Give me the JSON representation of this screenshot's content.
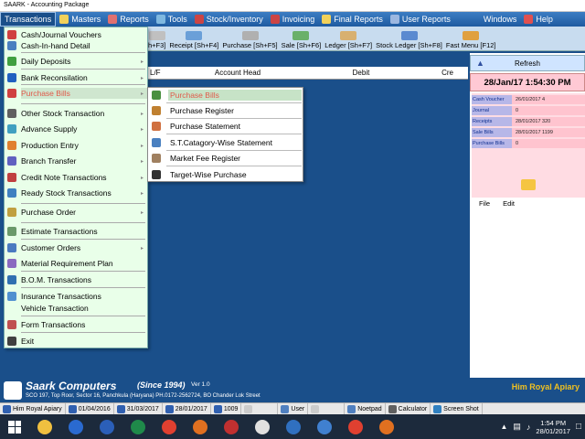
{
  "window_title": "SAARK - Accounting Package",
  "menubar": [
    {
      "label": "Transactions",
      "icon": "",
      "active": true
    },
    {
      "label": "Masters",
      "icon": "masters-icon",
      "color": "#f2d15a"
    },
    {
      "label": "Reports",
      "icon": "reports-icon",
      "color": "#e07070"
    },
    {
      "label": "Tools",
      "icon": "tools-icon",
      "color": "#7fb8e0"
    },
    {
      "label": "Stock/Inventory",
      "icon": "stock-icon",
      "color": "#cc4444"
    },
    {
      "label": "Invoicing",
      "icon": "invoicing-icon",
      "color": "#cc4444"
    },
    {
      "label": "Final Reports",
      "icon": "final-reports-icon",
      "color": "#f2d15a"
    },
    {
      "label": "User Reports",
      "icon": "user-reports-icon",
      "color": "#9cb7e0"
    },
    {
      "label": "Windows",
      "icon": "",
      "color": ""
    },
    {
      "label": "Help",
      "icon": "help-icon",
      "color": "#e05050"
    }
  ],
  "toolbar": [
    {
      "label": "h+F3]",
      "color": "#c0c0c0"
    },
    {
      "label": "Receipt [Sh+F4]",
      "color": "#6a9fd8"
    },
    {
      "label": "Purchase [Sh+F5]",
      "color": "#b0b0b0"
    },
    {
      "label": "Sale [Sh+F6]",
      "color": "#6ab06a"
    },
    {
      "label": "Ledger [Sh+F7]",
      "color": "#d8b070"
    },
    {
      "label": "Stock Ledger [Sh+F8]",
      "color": "#5a8ad0"
    },
    {
      "label": "Fast Menu [F12]",
      "color": "#e0a040"
    }
  ],
  "sheet_header": {
    "col1": "L/F",
    "col2": "Account Head",
    "col3": "Debit",
    "col4": "Cre"
  },
  "right_panel": {
    "refresh_label": "Refresh",
    "datetime": "28/Jan/17 1:54:30 PM",
    "info_rows": [
      {
        "label": "Cash Voucher",
        "value": "26/01/2017 4"
      },
      {
        "label": "Journal",
        "value": "0"
      },
      {
        "label": "Receipts",
        "value": "28/01/2017 320"
      },
      {
        "label": "Sale Bills",
        "value": "28/01/2017 1199"
      },
      {
        "label": "Purchase Bills",
        "value": "0"
      }
    ],
    "file_label": "File",
    "edit_label": "Edit"
  },
  "dropdown": {
    "items": [
      {
        "label": "Cash/Journal Vouchers",
        "arrow": false,
        "icon_color": "#d04040"
      },
      {
        "label": "Cash-In-hand Detail",
        "arrow": false,
        "icon_color": "#4a7fc0"
      },
      {
        "label": "Daily Deposits",
        "arrow": true,
        "icon_color": "#40a040"
      },
      {
        "label": "Bank  Reconsilation",
        "arrow": true,
        "icon_color": "#2060c0"
      },
      {
        "label": "Purchase Bills",
        "arrow": true,
        "icon_color": "#d04040",
        "highlighted": true
      },
      {
        "label": "Other Stock Transaction",
        "arrow": true,
        "icon_color": "#606060"
      },
      {
        "label": "Advance Supply",
        "arrow": true,
        "icon_color": "#40a0c0"
      },
      {
        "label": "Production Entry",
        "arrow": true,
        "icon_color": "#e08030"
      },
      {
        "label": "Branch Transfer",
        "arrow": true,
        "icon_color": "#6060c0"
      },
      {
        "label": "Credit Note Transactions",
        "arrow": true,
        "icon_color": "#c04040"
      },
      {
        "label": "Ready Stock Transactions",
        "arrow": true,
        "icon_color": "#4080c0"
      },
      {
        "label": "Purchase Order",
        "arrow": true,
        "icon_color": "#c0a040"
      },
      {
        "label": "Estimate Transactions",
        "arrow": false,
        "icon_color": "#6a9a6a"
      },
      {
        "label": "Customer Orders",
        "arrow": true,
        "icon_color": "#4a7ac0"
      },
      {
        "label": "Material Requirement Plan",
        "arrow": false,
        "icon_color": "#8a6ac0"
      },
      {
        "label": "B.O.M. Transactions",
        "arrow": false,
        "icon_color": "#3070b0"
      },
      {
        "label": "Insurance Transactions",
        "arrow": false,
        "icon_color": "#5090d0"
      },
      {
        "label": "Vehicle Transaction",
        "arrow": false,
        "icon_color": ""
      },
      {
        "label": "Form Transactions",
        "arrow": false,
        "icon_color": "#c05050"
      },
      {
        "label": "Exit",
        "arrow": false,
        "icon_color": "#404040"
      }
    ]
  },
  "submenu": {
    "items": [
      {
        "label": "Purchase Bills",
        "highlighted": true,
        "icon_color": "#4a9040"
      },
      {
        "label": "Purchase Register",
        "icon_color": "#c08030"
      },
      {
        "label": "Purchase Statement",
        "icon_color": "#d07040"
      },
      {
        "label": "S.T.Catagory-Wise Statement",
        "icon_color": "#4a80c0"
      },
      {
        "label": "Market Fee Register",
        "icon_color": "#a08060"
      },
      {
        "label": "Target-Wise Purchase",
        "icon_color": "#303030"
      }
    ]
  },
  "footer": {
    "brand": "Saark Computers",
    "since": "(Since 1994)",
    "version": "Ver 1.0",
    "address": "SCO 197, Top Roor, Sector 16, Panchkula (Haryana) PH.0172-2562724,  BO Chander Lok Street",
    "company": "Him Royal Apiary"
  },
  "statusbar": [
    {
      "label": "Him Royal Apiary",
      "icon_color": "#3060b0"
    },
    {
      "label": "01/04/2016",
      "icon_color": "#3060b0"
    },
    {
      "label": "31/03/2017",
      "icon_color": "#3060b0"
    },
    {
      "label": "28/01/2017",
      "icon_color": "#3060b0"
    },
    {
      "label": "1009",
      "icon_color": "#3060b0"
    },
    {
      "label": "",
      "icon_color": "#ccc"
    },
    {
      "label": "User",
      "icon_color": "#5080c0"
    },
    {
      "label": "",
      "icon_color": "#ccc"
    },
    {
      "label": "Noetpad",
      "icon_color": "#5080c0"
    },
    {
      "label": "Calculator",
      "icon_color": "#606060"
    },
    {
      "label": "Screen Shot",
      "icon_color": "#3080c0"
    }
  ],
  "taskbar": {
    "apps": [
      {
        "name": "file-explorer-icon",
        "color": "#f0c040"
      },
      {
        "name": "outlook-icon",
        "color": "#2a6ad0"
      },
      {
        "name": "word-icon",
        "color": "#2b5fb8"
      },
      {
        "name": "excel-icon",
        "color": "#1f8a4a"
      },
      {
        "name": "chrome-icon",
        "color": "#e04030"
      },
      {
        "name": "firefox-icon",
        "color": "#e07020"
      },
      {
        "name": "media-icon",
        "color": "#c03030"
      },
      {
        "name": "saark-icon",
        "color": "#e0e0e0"
      },
      {
        "name": "app-icon",
        "color": "#3070c0"
      },
      {
        "name": "windows-app-icon",
        "color": "#4080d0"
      },
      {
        "name": "chrome-icon-2",
        "color": "#e04030"
      },
      {
        "name": "firefox-icon-2",
        "color": "#e07020"
      }
    ],
    "time": "1:54 PM",
    "date": "28/01/2017"
  }
}
